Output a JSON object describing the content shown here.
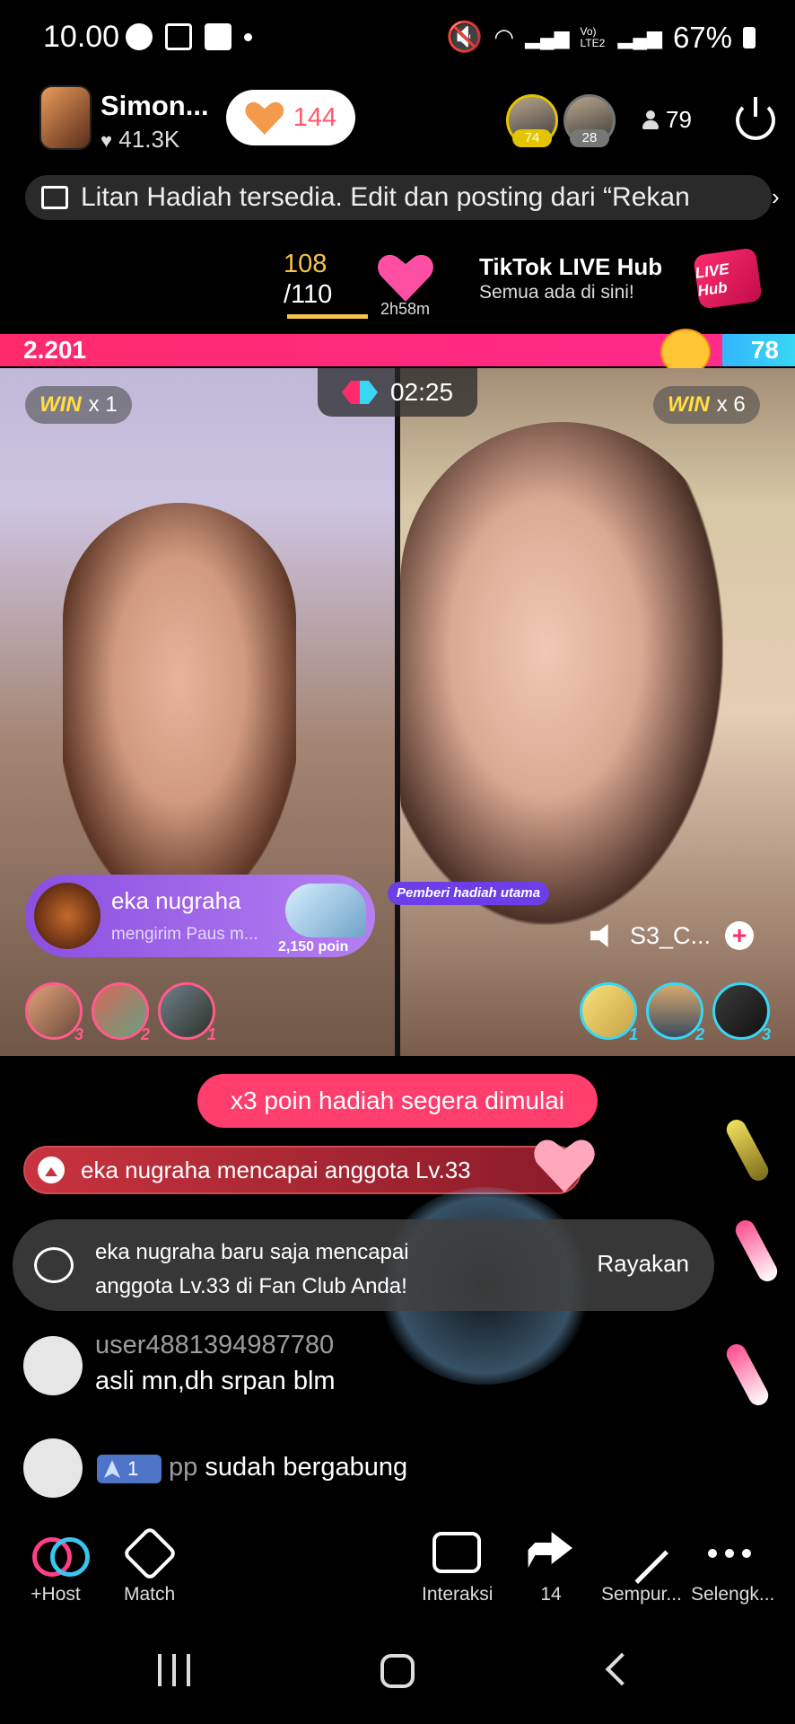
{
  "status_bar": {
    "time": "10.00",
    "battery": "67%",
    "network": "Vo) LTE2"
  },
  "header": {
    "host_name": "Simon...",
    "host_likes": "41.3K",
    "like_count": "144",
    "viewers": [
      {
        "badge": "74"
      },
      {
        "badge": "28"
      }
    ],
    "viewer_count": "79"
  },
  "ticker": {
    "text": "Litan Hadiah tersedia. Edit dan posting dari “Rekan"
  },
  "goal": {
    "current": "108",
    "target": "/110",
    "time_left": "2h58m"
  },
  "hub": {
    "title": "TikTok LIVE Hub",
    "subtitle": "Semua ada di sini!",
    "logo_text": "LIVE Hub"
  },
  "battle": {
    "left_score": "2.201",
    "right_score": "78",
    "timer": "02:25",
    "left_win_label": "WIN",
    "left_win_count": "x 1",
    "right_win_label": "WIN",
    "right_win_count": "x 6",
    "score_share_left": 0.909,
    "colors": {
      "left": "#ff2a6b",
      "right": "#39d6f3"
    }
  },
  "gift": {
    "sender": "eka nugraha",
    "message": "mengirim Paus m...",
    "points": "2,150 poin",
    "top_gifter_tag": "Pemberi hadiah utama"
  },
  "opponent": {
    "name": "S3_C...",
    "plus": "+"
  },
  "left_ranks": [
    {
      "n": "3"
    },
    {
      "n": "2"
    },
    {
      "n": "1"
    }
  ],
  "right_ranks": [
    {
      "n": "1"
    },
    {
      "n": "2"
    },
    {
      "n": "3"
    }
  ],
  "promo": {
    "text": "x3 poin hadiah segera dimulai"
  },
  "member_bar": {
    "text": "eka nugraha mencapai anggota Lv.33"
  },
  "fan_toast": {
    "line1": "eka nugraha baru saja mencapai",
    "line2": "anggota Lv.33 di Fan Club Anda!",
    "action": "Rayakan"
  },
  "comments": [
    {
      "user": "user4881394987780",
      "text": "asli mn,dh srpan blm"
    }
  ],
  "join": {
    "level": "1",
    "user": "pp",
    "text": "sudah bergabung"
  },
  "toolbar": {
    "host": "+Host",
    "match": "Match",
    "interaction": "Interaksi",
    "share_count": "14",
    "enhance": "Sempur...",
    "more": "Selengk..."
  }
}
